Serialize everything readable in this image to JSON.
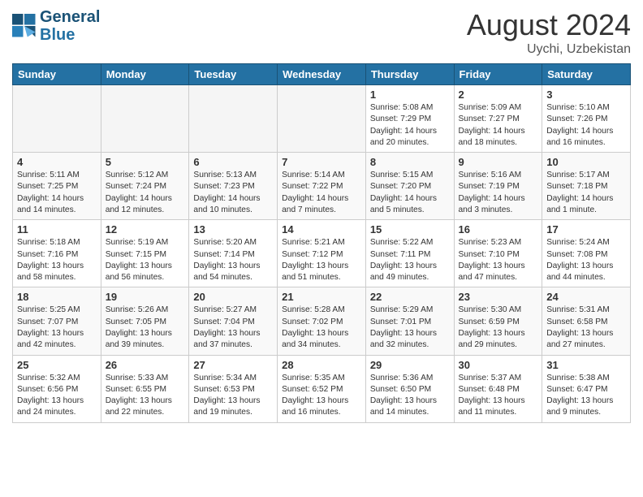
{
  "header": {
    "logo_line1": "General",
    "logo_line2": "Blue",
    "month": "August 2024",
    "location": "Uychi, Uzbekistan"
  },
  "weekdays": [
    "Sunday",
    "Monday",
    "Tuesday",
    "Wednesday",
    "Thursday",
    "Friday",
    "Saturday"
  ],
  "weeks": [
    [
      {
        "day": "",
        "info": ""
      },
      {
        "day": "",
        "info": ""
      },
      {
        "day": "",
        "info": ""
      },
      {
        "day": "",
        "info": ""
      },
      {
        "day": "1",
        "info": "Sunrise: 5:08 AM\nSunset: 7:29 PM\nDaylight: 14 hours\nand 20 minutes."
      },
      {
        "day": "2",
        "info": "Sunrise: 5:09 AM\nSunset: 7:27 PM\nDaylight: 14 hours\nand 18 minutes."
      },
      {
        "day": "3",
        "info": "Sunrise: 5:10 AM\nSunset: 7:26 PM\nDaylight: 14 hours\nand 16 minutes."
      }
    ],
    [
      {
        "day": "4",
        "info": "Sunrise: 5:11 AM\nSunset: 7:25 PM\nDaylight: 14 hours\nand 14 minutes."
      },
      {
        "day": "5",
        "info": "Sunrise: 5:12 AM\nSunset: 7:24 PM\nDaylight: 14 hours\nand 12 minutes."
      },
      {
        "day": "6",
        "info": "Sunrise: 5:13 AM\nSunset: 7:23 PM\nDaylight: 14 hours\nand 10 minutes."
      },
      {
        "day": "7",
        "info": "Sunrise: 5:14 AM\nSunset: 7:22 PM\nDaylight: 14 hours\nand 7 minutes."
      },
      {
        "day": "8",
        "info": "Sunrise: 5:15 AM\nSunset: 7:20 PM\nDaylight: 14 hours\nand 5 minutes."
      },
      {
        "day": "9",
        "info": "Sunrise: 5:16 AM\nSunset: 7:19 PM\nDaylight: 14 hours\nand 3 minutes."
      },
      {
        "day": "10",
        "info": "Sunrise: 5:17 AM\nSunset: 7:18 PM\nDaylight: 14 hours\nand 1 minute."
      }
    ],
    [
      {
        "day": "11",
        "info": "Sunrise: 5:18 AM\nSunset: 7:16 PM\nDaylight: 13 hours\nand 58 minutes."
      },
      {
        "day": "12",
        "info": "Sunrise: 5:19 AM\nSunset: 7:15 PM\nDaylight: 13 hours\nand 56 minutes."
      },
      {
        "day": "13",
        "info": "Sunrise: 5:20 AM\nSunset: 7:14 PM\nDaylight: 13 hours\nand 54 minutes."
      },
      {
        "day": "14",
        "info": "Sunrise: 5:21 AM\nSunset: 7:12 PM\nDaylight: 13 hours\nand 51 minutes."
      },
      {
        "day": "15",
        "info": "Sunrise: 5:22 AM\nSunset: 7:11 PM\nDaylight: 13 hours\nand 49 minutes."
      },
      {
        "day": "16",
        "info": "Sunrise: 5:23 AM\nSunset: 7:10 PM\nDaylight: 13 hours\nand 47 minutes."
      },
      {
        "day": "17",
        "info": "Sunrise: 5:24 AM\nSunset: 7:08 PM\nDaylight: 13 hours\nand 44 minutes."
      }
    ],
    [
      {
        "day": "18",
        "info": "Sunrise: 5:25 AM\nSunset: 7:07 PM\nDaylight: 13 hours\nand 42 minutes."
      },
      {
        "day": "19",
        "info": "Sunrise: 5:26 AM\nSunset: 7:05 PM\nDaylight: 13 hours\nand 39 minutes."
      },
      {
        "day": "20",
        "info": "Sunrise: 5:27 AM\nSunset: 7:04 PM\nDaylight: 13 hours\nand 37 minutes."
      },
      {
        "day": "21",
        "info": "Sunrise: 5:28 AM\nSunset: 7:02 PM\nDaylight: 13 hours\nand 34 minutes."
      },
      {
        "day": "22",
        "info": "Sunrise: 5:29 AM\nSunset: 7:01 PM\nDaylight: 13 hours\nand 32 minutes."
      },
      {
        "day": "23",
        "info": "Sunrise: 5:30 AM\nSunset: 6:59 PM\nDaylight: 13 hours\nand 29 minutes."
      },
      {
        "day": "24",
        "info": "Sunrise: 5:31 AM\nSunset: 6:58 PM\nDaylight: 13 hours\nand 27 minutes."
      }
    ],
    [
      {
        "day": "25",
        "info": "Sunrise: 5:32 AM\nSunset: 6:56 PM\nDaylight: 13 hours\nand 24 minutes."
      },
      {
        "day": "26",
        "info": "Sunrise: 5:33 AM\nSunset: 6:55 PM\nDaylight: 13 hours\nand 22 minutes."
      },
      {
        "day": "27",
        "info": "Sunrise: 5:34 AM\nSunset: 6:53 PM\nDaylight: 13 hours\nand 19 minutes."
      },
      {
        "day": "28",
        "info": "Sunrise: 5:35 AM\nSunset: 6:52 PM\nDaylight: 13 hours\nand 16 minutes."
      },
      {
        "day": "29",
        "info": "Sunrise: 5:36 AM\nSunset: 6:50 PM\nDaylight: 13 hours\nand 14 minutes."
      },
      {
        "day": "30",
        "info": "Sunrise: 5:37 AM\nSunset: 6:48 PM\nDaylight: 13 hours\nand 11 minutes."
      },
      {
        "day": "31",
        "info": "Sunrise: 5:38 AM\nSunset: 6:47 PM\nDaylight: 13 hours\nand 9 minutes."
      }
    ]
  ]
}
